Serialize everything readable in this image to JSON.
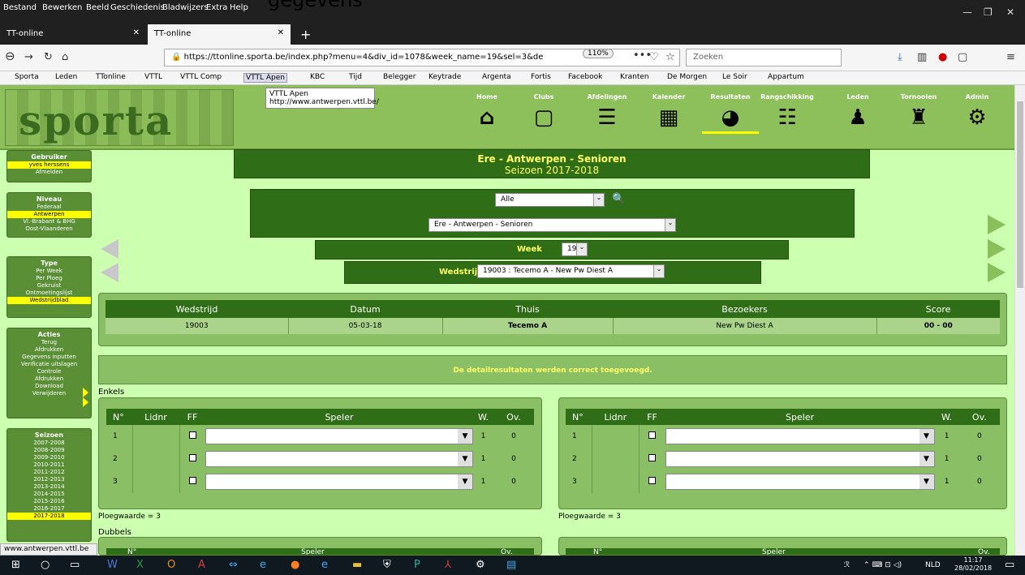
{
  "ghost_text": "gegevens",
  "menu": [
    "Bestand",
    "Bewerken",
    "Beeld",
    "Geschiedenis",
    "Bladwijzers",
    "Extra",
    "Help"
  ],
  "tabs": [
    {
      "label": "TT-online"
    },
    {
      "label": "TT-online"
    }
  ],
  "url": "https://ttonline.sporta.be/index.php?menu=4&div_id=1078&week_name=19&sel=3&de",
  "zoom": "110%",
  "search_placeholder": "Zoeken",
  "bookmarks": [
    "Sporta",
    "Leden",
    "TTonline",
    "VTTL",
    "VTTL Comp",
    "VTTL Apen",
    "KBC",
    "Tijd",
    "Belegger",
    "Keytrade",
    "Argenta",
    "Fortis",
    "Facebook",
    "Kranten",
    "De Morgen",
    "Le Soir",
    "Appartum"
  ],
  "tooltip": {
    "title": "VTTL Apen",
    "url": "http://www.antwerpen.vttl.be/"
  },
  "logo": "sporta",
  "topnav": [
    "Home",
    "Clubs",
    "Afdelingen",
    "Kalender",
    "Resultaten",
    "Rangschikking",
    "Leden",
    "Tornooien",
    "Admin"
  ],
  "sidebar": {
    "gebruiker": {
      "title": "Gebruiker",
      "items": [
        "yves herssens",
        "Afmelden"
      ]
    },
    "niveau": {
      "title": "Niveau",
      "items": [
        "Federaal",
        "Antwerpen",
        "Vl.-Brabant & BHG",
        "Oost-Vlaanderen"
      ]
    },
    "type": {
      "title": "Type",
      "items": [
        "Per Week",
        "Per Ploeg",
        "Gekruist",
        "Ontmoetingslijst",
        "Wedstrijdblad"
      ]
    },
    "acties": {
      "title": "Acties",
      "items": [
        "Terug",
        "Afdrukken",
        "Gegevens inputten",
        "Verificatie uitslagen",
        "Controle",
        "Afdrukken",
        "Download",
        "Verwijderen"
      ]
    },
    "seizoen": {
      "title": "Seizoen",
      "items": [
        "2007-2008",
        "2008-2009",
        "2009-2010",
        "2010-2011",
        "2011-2012",
        "2012-2013",
        "2013-2014",
        "2014-2015",
        "2015-2016",
        "2016-2017",
        "2017-2018"
      ]
    }
  },
  "main": {
    "title": "Ere - Antwerpen - Senioren",
    "season": "Seizoen 2017-2018",
    "filter_all": "Alle",
    "division_select": "Ere - Antwerpen - Senioren",
    "week_label": "Week",
    "week_value": "19",
    "match_label": "Wedstrijd",
    "match_value": "19003 : Tecemo A - New Pw Diest A",
    "match_table": {
      "headers": [
        "Wedstrijd",
        "Datum",
        "Thuis",
        "Bezoekers",
        "Score"
      ],
      "row": [
        "19003",
        "05-03-18",
        "Tecemo A",
        "New Pw Diest A",
        "00 - 00"
      ]
    },
    "message": "De detailresultaten werden correct toegevoegd.",
    "enkels_label": "Enkels",
    "player_headers": [
      "N°",
      "Lidnr",
      "FF",
      "Speler",
      "W.",
      "Ov."
    ],
    "players": [
      {
        "n": "1",
        "w": "1",
        "ov": "0"
      },
      {
        "n": "2",
        "w": "1",
        "ov": "0"
      },
      {
        "n": "3",
        "w": "1",
        "ov": "0"
      }
    ],
    "ploegwaarde": "Ploegwaarde = 3",
    "dubbels_label": "Dubbels",
    "dubbels_headers": [
      "N°",
      "Speler",
      "Ov."
    ]
  },
  "status_url": "www.antwerpen.vttl.be",
  "taskbar": {
    "lang": "NLD",
    "time": "11:17",
    "date": "28/02/2018"
  }
}
